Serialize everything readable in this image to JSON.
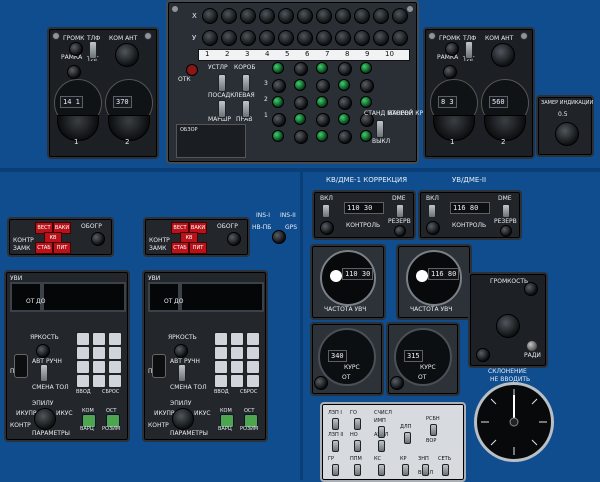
{
  "left_radio": {
    "labels": [
      "ГРОМК",
      "ТЛФ",
      "КОМ АНТ",
      "РАМКА",
      "ТЛГ"
    ],
    "dial1": {
      "num": "1",
      "digits": "14 1"
    },
    "dial2": {
      "num": "2",
      "digits": "370"
    }
  },
  "nav_matrix": {
    "row_x": "X",
    "row_y": "У",
    "numbers": [
      "1",
      "2",
      "3",
      "4",
      "5",
      "6",
      "7",
      "8",
      "9",
      "10"
    ],
    "lamp_label": "ОТК",
    "center_labels": [
      "УСТЛР",
      "КОРОБ",
      "ПОСАДК",
      "ЛЕВАЯ",
      "МАРШР",
      "ПРАВ"
    ],
    "switch_labels": [
      "СТАНД МАНЕВР",
      "ВТОРОЙ КРУГ",
      "ВЫКЛ"
    ],
    "row_labels": [
      "3",
      "2",
      "1",
      "3",
      "2",
      "1"
    ],
    "lower_legend": "ОБЗОР"
  },
  "right_radio": {
    "labels": [
      "ГРОМК",
      "ТЛФ",
      "КОМ АНТ",
      "РАМКА",
      "ТЛГ"
    ],
    "dial1": {
      "num": "1",
      "digits": "8 3"
    },
    "dial2": {
      "num": "2",
      "digits": "560"
    }
  },
  "small_box": {
    "title": "ЗАМЕР ИНДИКАЦИИ",
    "value": "0.5"
  },
  "ins_switch": {
    "left": "INS-I",
    "right": "INS-II",
    "label_left": "НВ-ПБ",
    "label_right": "GPS"
  },
  "mode_panel_1": {
    "btns": [
      "ВЕСТ",
      "ВАКИ",
      "КВ",
      "СТАБ",
      "ПИТ"
    ],
    "labels": [
      "КОНТР",
      "ОБОГР",
      "ЗАМК"
    ]
  },
  "mode_panel_2": {
    "btns": [
      "ВЕСТ",
      "ВАКИ",
      "КВ",
      "СТАБ",
      "ПИТ"
    ],
    "labels": [
      "КОНТР",
      "ОБОГР",
      "ЗАМК"
    ]
  },
  "cdu_left": {
    "title": "УВИ",
    "labels": [
      "ОТ",
      "ДО",
      "ЯРКОСТЬ",
      "АВТ",
      "РУЧН",
      "СМЕНА ТОЛ",
      "ЭПИЛУ",
      "ПЛМ",
      "ИКУПР",
      "ИКУС",
      "КОНТР",
      "ПАРАМЕТРЫ"
    ],
    "buttons": [
      "ВВОД",
      "СБРОС",
      "КОМ",
      "ВАРЦ",
      "ОСТ",
      "РОЗИМ"
    ]
  },
  "cdu_right": {
    "title": "УВИ",
    "labels": [
      "ОТ",
      "ДО",
      "ЯРКОСТЬ",
      "АВТ",
      "РУЧН",
      "СМЕНА ТОЛ",
      "ЭПИЛУ",
      "ПЛМ",
      "ИКУПР",
      "ИКУС",
      "КОНТР",
      "ПАРАМЕТРЫ"
    ],
    "buttons": [
      "ВВОД",
      "СБРОС",
      "КОМ",
      "ВАРЦ",
      "ОСТ",
      "РОЗИМ"
    ]
  },
  "nav_header": {
    "left": "КВ/ДМЕ-1 КОРРЕКЦИЯ",
    "right": "УВ/ДМЕ-II"
  },
  "freq1": {
    "vkl": "ВКЛ",
    "dme": "DME",
    "value": "110 30",
    "rezerv": "РЕЗЕРВ",
    "kontr": "КОНТРОЛЬ"
  },
  "freq2": {
    "vkl": "ВКЛ",
    "dme": "DME",
    "value": "116 80",
    "rezerv": "РЕЗЕРВ",
    "kontr": "КОНТРОЛЬ"
  },
  "dial_freq1": {
    "value": "110 30",
    "caption": "ЧАСТОТА УВЧ"
  },
  "dial_freq2": {
    "value": "116 80",
    "caption": "ЧАСТОТА УВЧ"
  },
  "course1": {
    "value": "340",
    "caption": "КУРС",
    "ot": "ОТ"
  },
  "course2": {
    "value": "315",
    "caption": "КУРС",
    "ot": "ОТ"
  },
  "gain": {
    "title": "ГРОМКОСТЬ",
    "label": "РАДИ"
  },
  "declination": {
    "title": "СКЛОНЕНИЕ",
    "subtitle": "НЕ ВВОДИТЬ"
  },
  "switch_box": {
    "labels": [
      "ЛЗП I",
      "ГО",
      "СЧИСЛ",
      "ИМП",
      "РСБН",
      "ЛЗП II",
      "НО",
      "АНАЛ",
      "ДЛП",
      "ВОР",
      "ГР",
      "ППМ",
      "КС",
      "КР",
      "ЗНП",
      "СЕТЬ",
      "ВЫКЛ"
    ]
  }
}
